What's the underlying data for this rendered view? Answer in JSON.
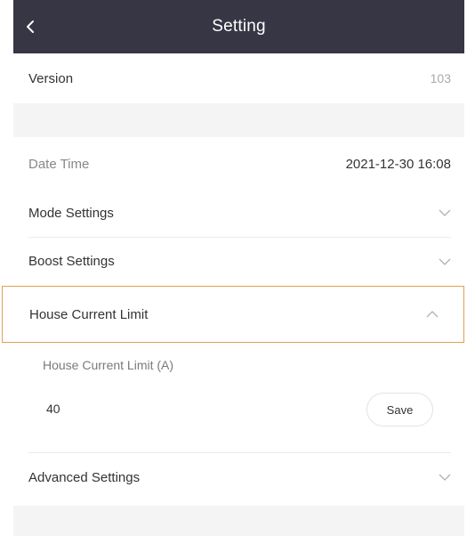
{
  "header": {
    "title": "Setting",
    "back_icon": "chevron-left-icon"
  },
  "version": {
    "label": "Version",
    "value": "103"
  },
  "date_time": {
    "label": "Date Time",
    "value": "2021-12-30 16:08"
  },
  "mode_settings": {
    "label": "Mode Settings",
    "icon": "chevron-down-icon"
  },
  "boost_settings": {
    "label": "Boost Settings",
    "icon": "chevron-down-icon"
  },
  "house_current_limit": {
    "label": "House Current Limit",
    "icon": "chevron-up-icon",
    "field_label": "House Current Limit (A)",
    "value": "40",
    "save_label": "Save",
    "highlight_color": "#e0a052"
  },
  "advanced_settings": {
    "label": "Advanced Settings",
    "icon": "chevron-down-icon"
  },
  "colors": {
    "header_bg": "#363645",
    "band_bg": "#f4f4f4"
  }
}
